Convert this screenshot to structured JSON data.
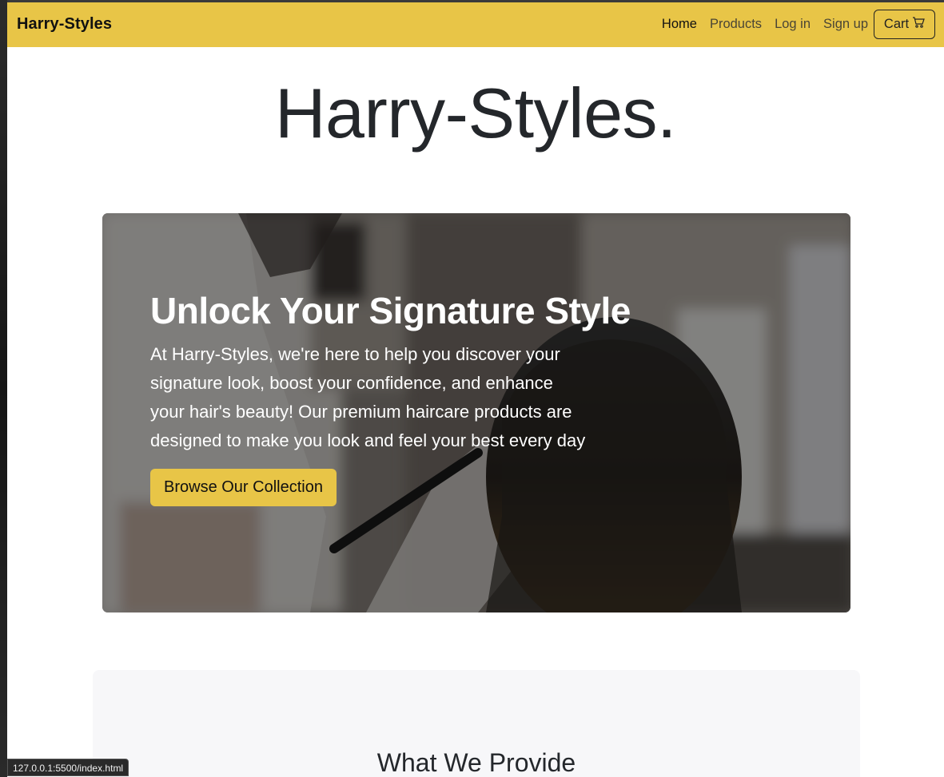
{
  "navbar": {
    "brand": "Harry-Styles",
    "links": [
      {
        "label": "Home",
        "active": true
      },
      {
        "label": "Products",
        "active": false
      },
      {
        "label": "Log in",
        "active": false
      },
      {
        "label": "Sign up",
        "active": false
      }
    ],
    "cart_label": "Cart",
    "cart_icon": "cart-icon",
    "background_color": "#e8c547"
  },
  "site_heading": "Harry-Styles.",
  "hero": {
    "title": "Unlock Your Signature Style",
    "text": "At Harry-Styles, we're here to help you discover your signature look, boost your confidence, and enhance your hair's beauty! Our premium haircare products are designed to make you look and feel your best every day",
    "button_label": "Browse Our Collection",
    "button_color": "#e8c547"
  },
  "provide": {
    "title": "What We Provide"
  },
  "status_bar": {
    "url": "127.0.0.1:5500/index.html"
  }
}
